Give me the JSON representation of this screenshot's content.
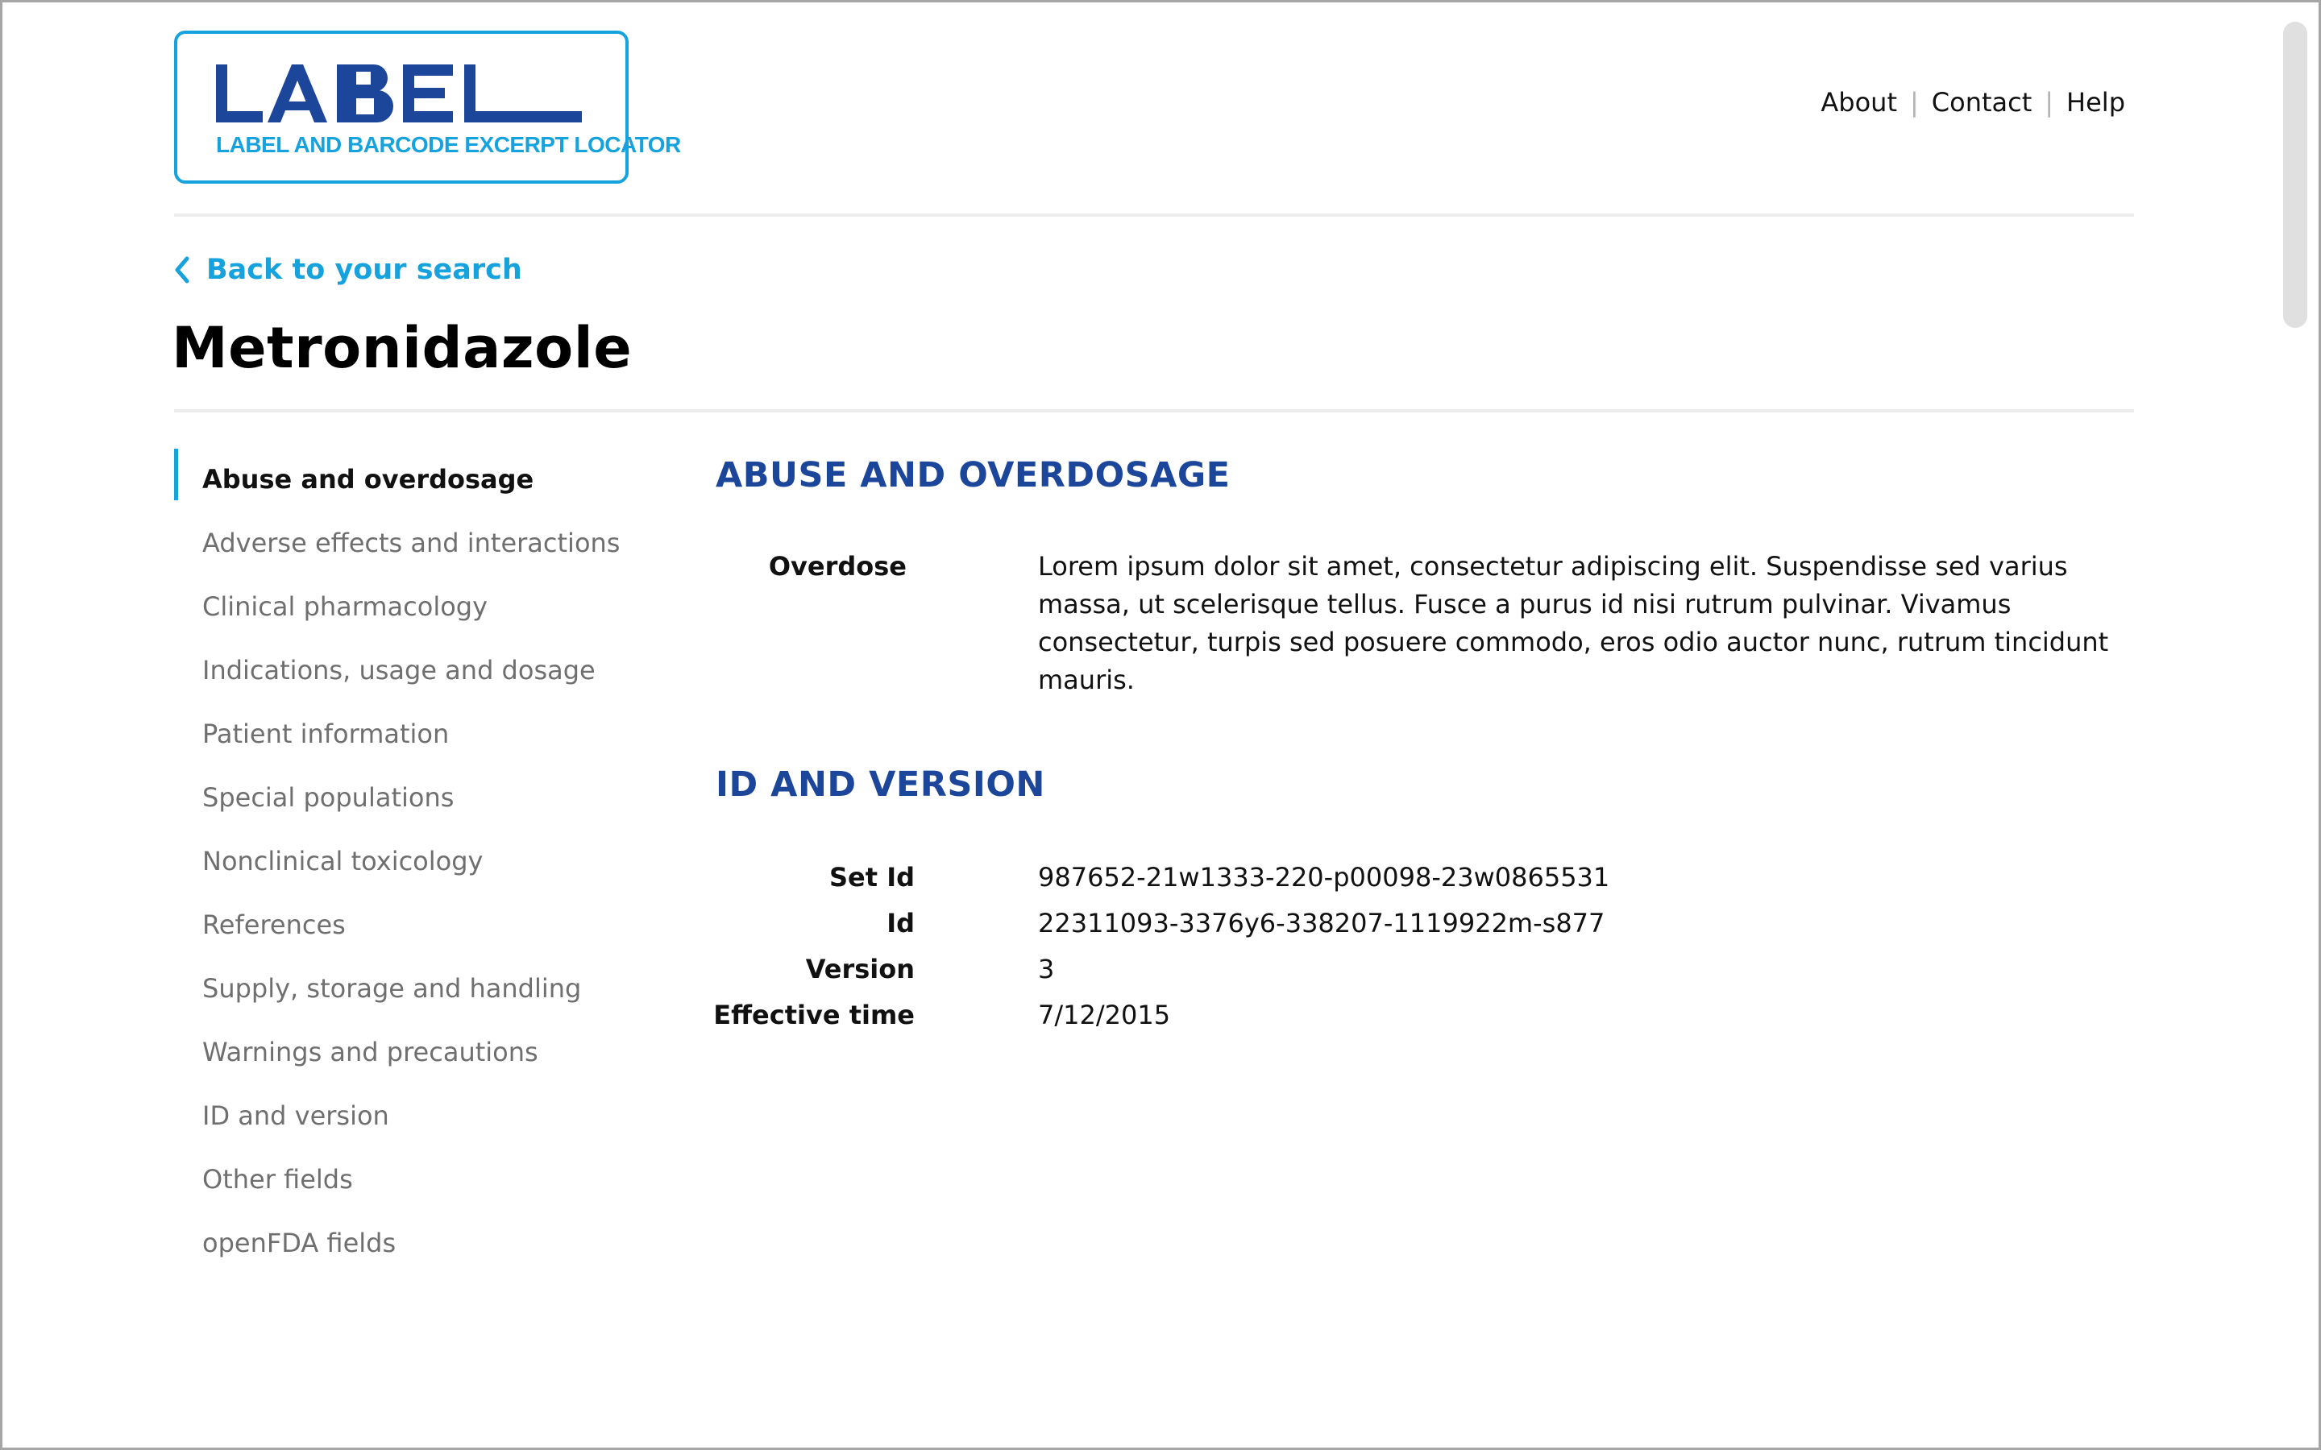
{
  "colors": {
    "accent": "#15a2dd",
    "heading": "#1b469a",
    "muted_text": "#6f6f6f",
    "rule": "#ececec"
  },
  "logo": {
    "wordmark": "LABEL",
    "tagline": "LABEL AND BARCODE EXCERPT LOCATOR"
  },
  "top_nav": {
    "items": [
      "About",
      "Contact",
      "Help"
    ]
  },
  "back_link": {
    "icon": "chevron-left-icon",
    "label": "Back to your search"
  },
  "page_title": "Metronidazole",
  "sidebar": {
    "items": [
      {
        "label": "Abuse and overdosage",
        "active": true
      },
      {
        "label": "Adverse effects and interactions",
        "active": false
      },
      {
        "label": "Clinical pharmacology",
        "active": false
      },
      {
        "label": "Indications, usage and dosage",
        "active": false
      },
      {
        "label": "Patient information",
        "active": false
      },
      {
        "label": "Special populations",
        "active": false
      },
      {
        "label": "Nonclinical toxicology",
        "active": false
      },
      {
        "label": "References",
        "active": false
      },
      {
        "label": "Supply, storage and handling",
        "active": false
      },
      {
        "label": "Warnings and precautions",
        "active": false
      },
      {
        "label": "ID and version",
        "active": false
      },
      {
        "label": "Other fields",
        "active": false
      },
      {
        "label": "openFDA fields",
        "active": false
      }
    ]
  },
  "sections": {
    "abuse": {
      "heading": "ABUSE AND OVERDOSAGE",
      "field_label": "Overdose",
      "field_value": "Lorem ipsum dolor sit amet, consectetur adipiscing elit. Suspendisse sed varius massa, ut scelerisque tellus. Fusce a purus id nisi rutrum pulvinar. Vivamus consectetur, turpis sed posuere commodo, eros odio auctor nunc, rutrum tincidunt mauris."
    },
    "id_version": {
      "heading": "ID AND VERSION",
      "rows": [
        {
          "label": "Set Id",
          "value": "987652-21w1333-220-p00098-23w0865531"
        },
        {
          "label": "Id",
          "value": "22311093-3376y6-338207-1119922m-s877"
        },
        {
          "label": "Version",
          "value": "3"
        },
        {
          "label": "Effective time",
          "value": "7/12/2015"
        }
      ]
    }
  }
}
